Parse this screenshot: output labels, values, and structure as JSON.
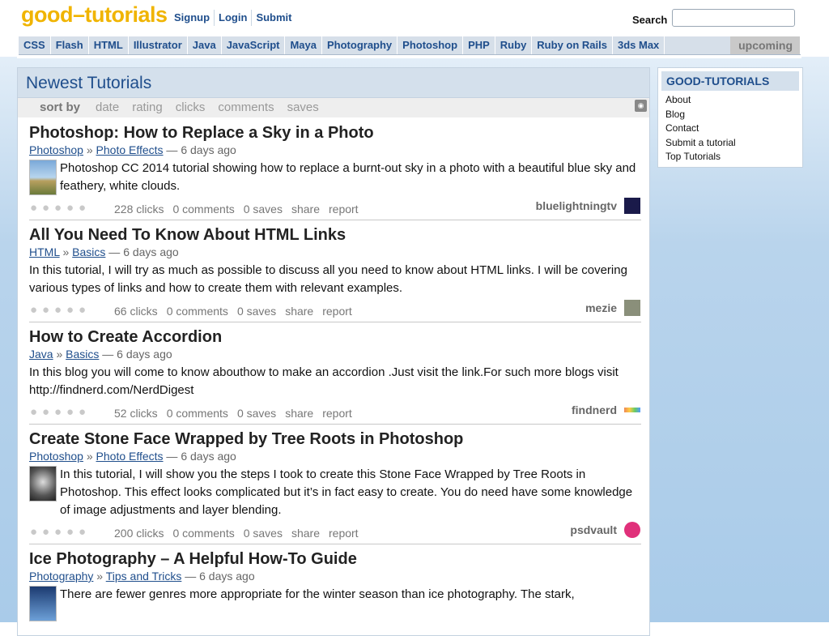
{
  "header": {
    "logo_part1": "good",
    "logo_part2": "tutorials",
    "links": [
      "Signup",
      "Login",
      "Submit"
    ],
    "search_label": "Search",
    "search_value": ""
  },
  "categories": [
    "CSS",
    "Flash",
    "HTML",
    "Illustrator",
    "Java",
    "JavaScript",
    "Maya",
    "Photography",
    "Photoshop",
    "PHP",
    "Ruby",
    "Ruby on Rails",
    "3ds Max"
  ],
  "upcoming": "upcoming",
  "main": {
    "title": "Newest Tutorials",
    "sort_label": "sort by",
    "sort_options": [
      "date",
      "rating",
      "clicks",
      "comments",
      "saves"
    ]
  },
  "items": [
    {
      "title": "Photoshop: How to Replace a Sky in a Photo",
      "category": "Photoshop",
      "subcategory": "Photo Effects",
      "age": "6 days ago",
      "description": "Photoshop CC 2014 tutorial showing how to replace a burnt-out sky in a photo with a beautiful blue sky and feathery, white clouds.",
      "clicks": "228 clicks",
      "comments": "0 comments",
      "saves": "0 saves",
      "share": "share",
      "report": "report",
      "author": "bluelightningtv",
      "thumb": "sky"
    },
    {
      "title": "All You Need To Know About HTML Links",
      "category": "HTML",
      "subcategory": "Basics",
      "age": "6 days ago",
      "description": "In this tutorial, I will try as much as possible to discuss all you need to know about HTML links. I will be covering various types of links and how to create them with relevant examples.",
      "clicks": "66 clicks",
      "comments": "0 comments",
      "saves": "0 saves",
      "share": "share",
      "report": "report",
      "author": "mezie",
      "thumb": ""
    },
    {
      "title": "How to Create Accordion",
      "category": "Java",
      "subcategory": "Basics",
      "age": "6 days ago",
      "description": "In this blog you will come to know abouthow to make an accordion .Just visit the link.For such more blogs visit http://findnerd.com/NerdDigest",
      "clicks": "52 clicks",
      "comments": "0 comments",
      "saves": "0 saves",
      "share": "share",
      "report": "report",
      "author": "findnerd",
      "thumb": ""
    },
    {
      "title": "Create Stone Face Wrapped by Tree Roots in Photoshop",
      "category": "Photoshop",
      "subcategory": "Photo Effects",
      "age": "6 days ago",
      "description": "In this tutorial, I will show you the steps I took to create this Stone Face Wrapped by Tree Roots in Photoshop. This effect looks complicated but it’s in fact easy to create. You do need have some knowledge of image adjustments and layer blending.",
      "clicks": "200 clicks",
      "comments": "0 comments",
      "saves": "0 saves",
      "share": "share",
      "report": "report",
      "author": "psdvault",
      "thumb": "stone"
    },
    {
      "title": "Ice Photography – A Helpful How-To Guide",
      "category": "Photography",
      "subcategory": "Tips and Tricks",
      "age": "6 days ago",
      "description": "There are fewer genres more appropriate for the winter season than ice photography. The stark,",
      "clicks": "",
      "comments": "",
      "saves": "",
      "share": "",
      "report": "",
      "author": "",
      "thumb": "ice"
    }
  ],
  "sidebar": {
    "title": "GOOD-TUTORIALS",
    "links": [
      "About",
      "Blog",
      "Contact",
      "Submit a tutorial",
      "Top Tutorials"
    ]
  },
  "colors": {
    "accent": "#1f4e8c",
    "logo": "#f0b400",
    "panel_header": "#d4e0ec"
  },
  "icons": {
    "rss": "rss-icon",
    "star": "rating-star-icon"
  }
}
